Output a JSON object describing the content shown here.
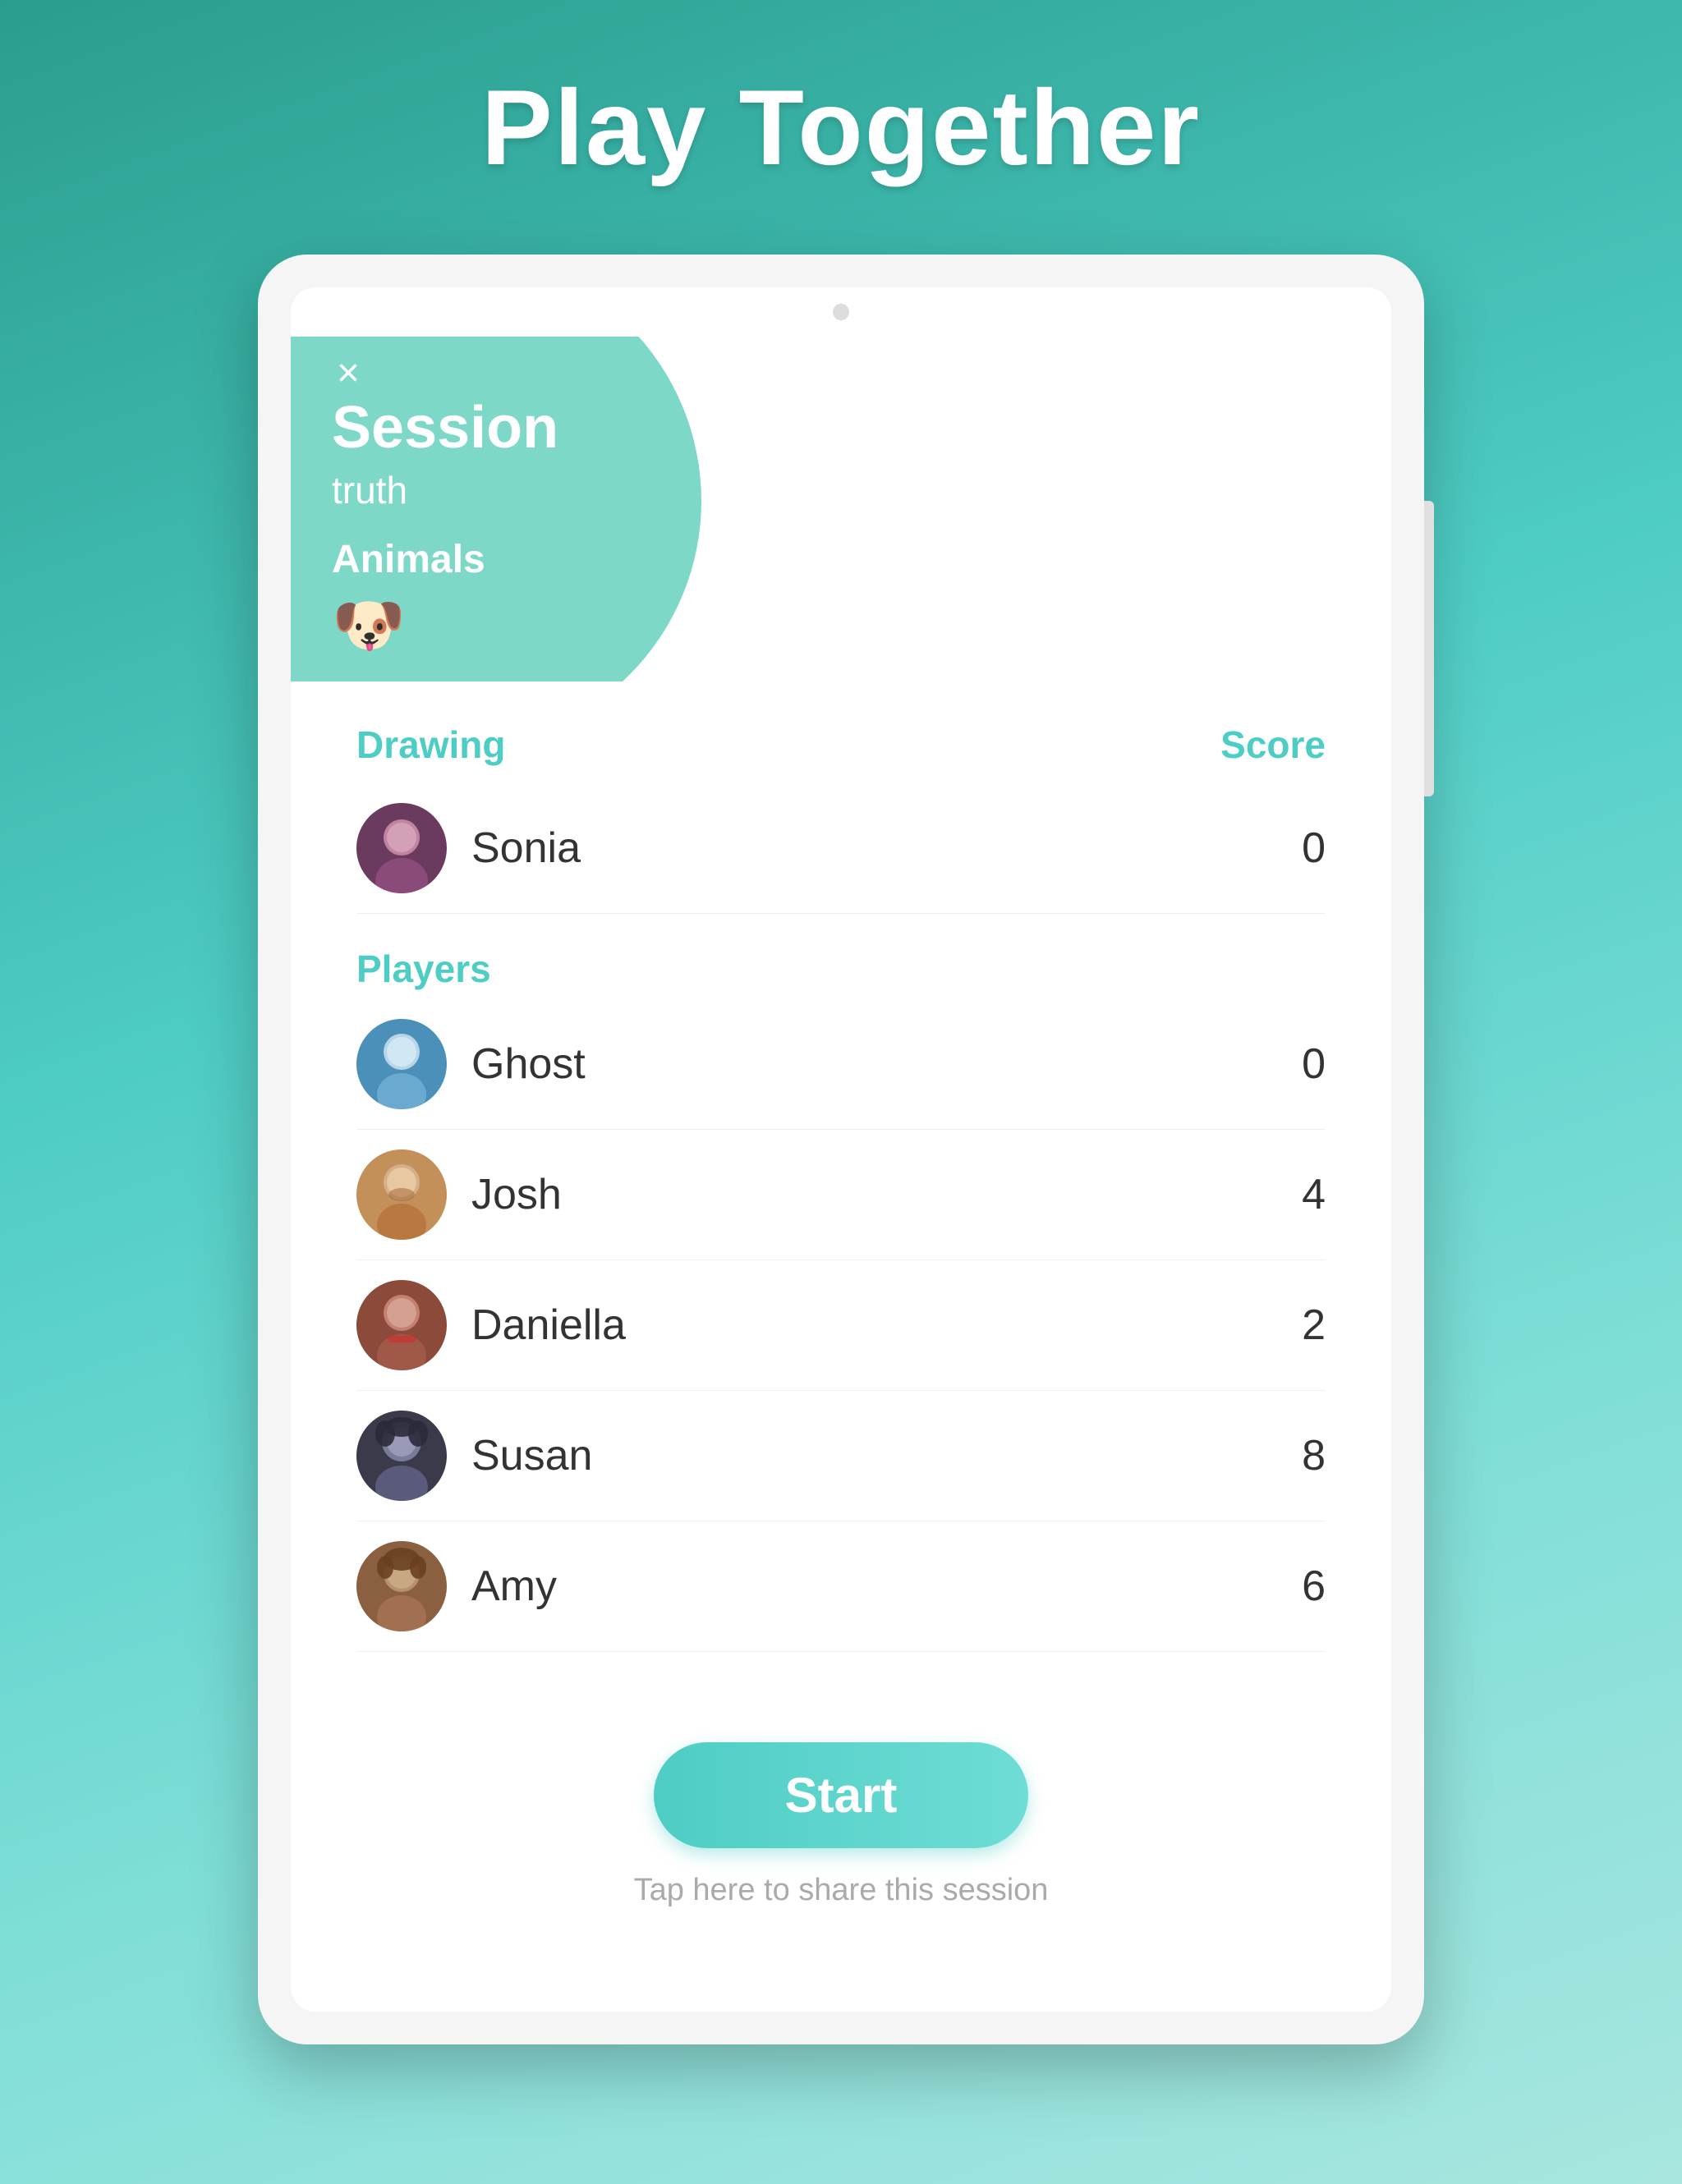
{
  "app": {
    "title": "Play Together"
  },
  "session": {
    "close_label": "×",
    "title": "Session",
    "type": "truth",
    "category": "Animals",
    "category_emoji": "🐶"
  },
  "drawing_section": {
    "label": "Drawing",
    "score_label": "Score"
  },
  "drawing_player": {
    "name": "Sonia",
    "score": "0"
  },
  "players_section": {
    "label": "Players"
  },
  "players": [
    {
      "name": "Ghost",
      "score": "0"
    },
    {
      "name": "Josh",
      "score": "4"
    },
    {
      "name": "Daniella",
      "score": "2"
    },
    {
      "name": "Susan",
      "score": "8"
    },
    {
      "name": "Amy",
      "score": "6"
    }
  ],
  "actions": {
    "start_label": "Start",
    "share_label": "Tap here to share this session"
  }
}
